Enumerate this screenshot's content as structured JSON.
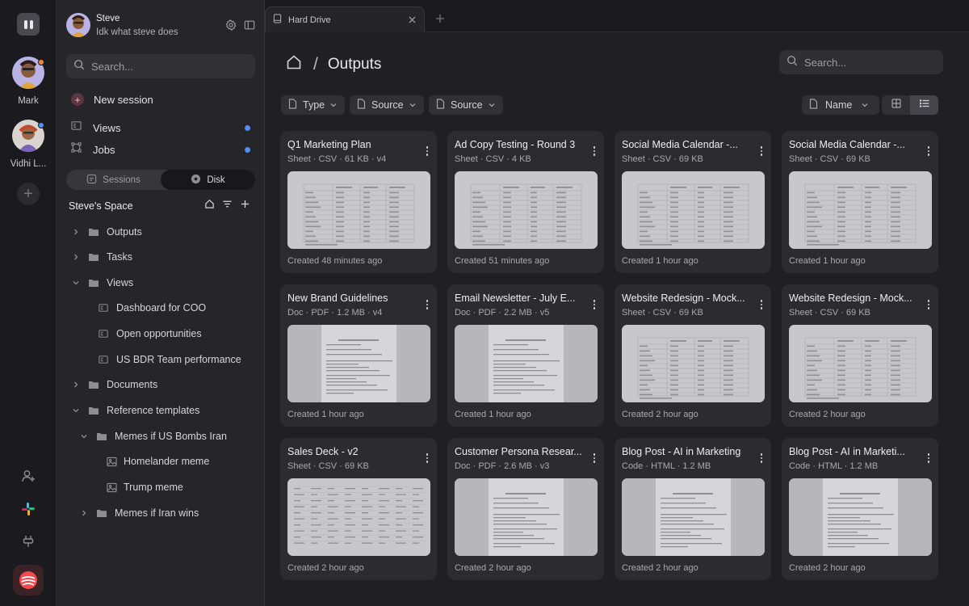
{
  "rail": {
    "users": [
      {
        "name": "Mark",
        "status_color": "#f08a3c"
      },
      {
        "name": "Vidhi L...",
        "status_color": "#4f8ff7"
      }
    ],
    "bottom_icons": [
      "add-user-icon",
      "slack-icon",
      "plug-icon"
    ]
  },
  "profile": {
    "name": "Steve",
    "subtitle": "Idk what steve does"
  },
  "sidebar": {
    "search_placeholder": "Search...",
    "new_session": "New session",
    "nav": [
      {
        "label": "Views"
      },
      {
        "label": "Jobs"
      }
    ],
    "segments": {
      "sessions": "Sessions",
      "disk": "Disk",
      "active": "Disk"
    },
    "space_title": "Steve's Space",
    "tree": [
      {
        "label": "Outputs",
        "type": "folder",
        "expanded": false
      },
      {
        "label": "Tasks",
        "type": "folder",
        "expanded": false
      },
      {
        "label": "Views",
        "type": "folder",
        "expanded": true
      },
      {
        "label": "Dashboard for COO",
        "type": "view"
      },
      {
        "label": "Open opportunities",
        "type": "view"
      },
      {
        "label": "US BDR Team performance",
        "type": "view"
      },
      {
        "label": "Documents",
        "type": "folder",
        "expanded": false
      },
      {
        "label": "Reference templates",
        "type": "folder",
        "expanded": true
      },
      {
        "label": "Memes if US Bombs Iran",
        "type": "folder",
        "expanded": true
      },
      {
        "label": "Homelander meme",
        "type": "image"
      },
      {
        "label": "Trump meme",
        "type": "image"
      },
      {
        "label": "Memes if Iran wins",
        "type": "folder",
        "expanded": false
      }
    ]
  },
  "tab": {
    "label": "Hard Drive"
  },
  "main": {
    "breadcrumb_sep": "/",
    "title": "Outputs",
    "search_placeholder": "Search...",
    "filters": [
      {
        "label": "Type"
      },
      {
        "label": "Source"
      },
      {
        "label": "Source"
      }
    ],
    "sort_label": "Name",
    "view_mode": "list"
  },
  "cards": [
    {
      "title": "Q1 Marketing Plan",
      "meta": "Sheet · CSV · 61 KB · v4",
      "created": "Created 48 minutes ago",
      "preview": "sheet"
    },
    {
      "title": "Ad Copy Testing - Round 3",
      "meta": "Sheet · CSV · 4 KB",
      "created": "Created 51 minutes ago",
      "preview": "sheet"
    },
    {
      "title": "Social Media Calendar -...",
      "meta": "Sheet · CSV · 69 KB",
      "created": "Created 1 hour ago",
      "preview": "sheet"
    },
    {
      "title": "Social Media Calendar -...",
      "meta": "Sheet · CSV · 69 KB",
      "created": "Created 1 hour ago",
      "preview": "sheet"
    },
    {
      "title": "New Brand Guidelines",
      "meta": "Doc · PDF · 1.2 MB · v4",
      "created": "Created 1 hour ago",
      "preview": "doc"
    },
    {
      "title": "Email Newsletter - July E...",
      "meta": "Doc · PDF · 2.2 MB · v5",
      "created": "Created 1 hour ago",
      "preview": "doc"
    },
    {
      "title": "Website Redesign - Mock...",
      "meta": "Sheet · CSV · 69 KB",
      "created": "Created 2 hour ago",
      "preview": "sheet"
    },
    {
      "title": "Website Redesign - Mock...",
      "meta": "Sheet · CSV · 69 KB",
      "created": "Created 2 hour ago",
      "preview": "sheet"
    },
    {
      "title": "Sales Deck - v2",
      "meta": "Sheet · CSV · 69 KB",
      "created": "Created 2 hour ago",
      "preview": "wide-sheet"
    },
    {
      "title": "Customer Persona Resear...",
      "meta": "Doc · PDF · 2.6 MB · v3",
      "created": "Created 2 hour ago",
      "preview": "doc"
    },
    {
      "title": "Blog Post - AI in Marketing",
      "meta": "Code  · HTML · 1.2 MB",
      "created": "Created 2 hour ago",
      "preview": "doc"
    },
    {
      "title": "Blog Post - AI in Marketi...",
      "meta": "Code  · HTML · 1.2 MB",
      "created": "Created 2 hour ago",
      "preview": "doc"
    }
  ]
}
